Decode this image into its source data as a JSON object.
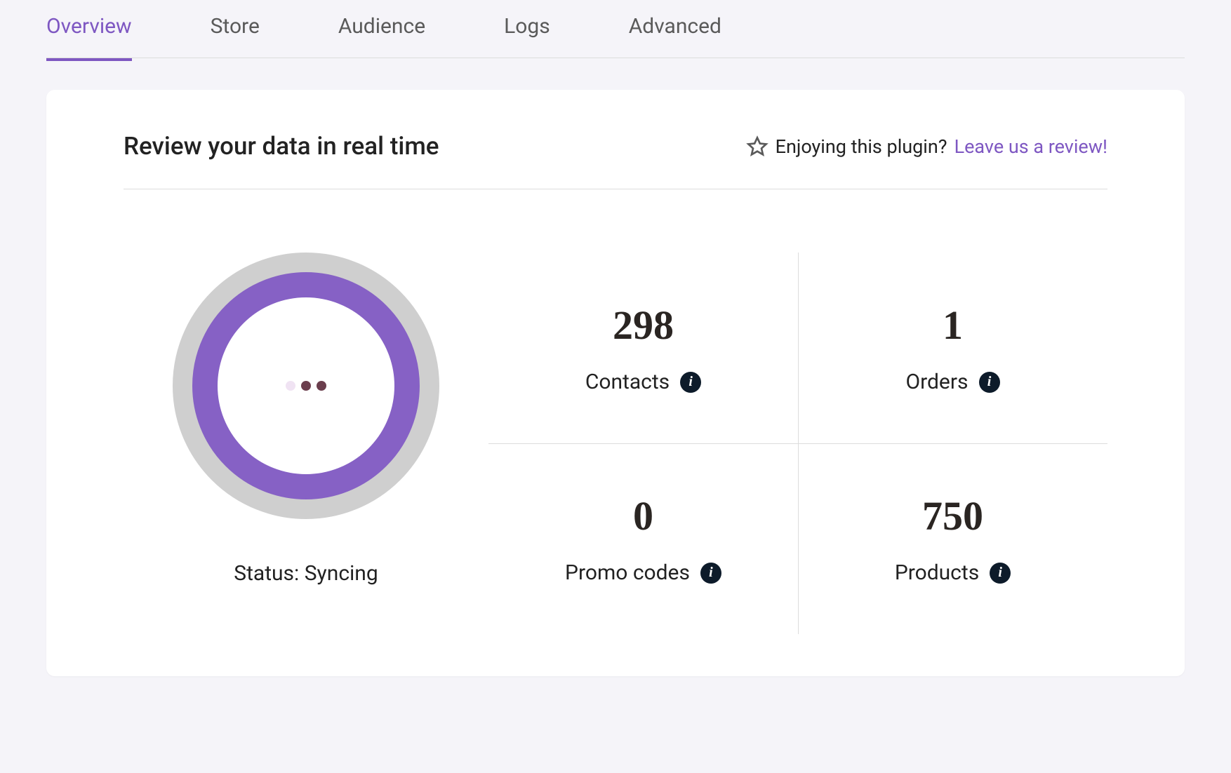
{
  "tabs": [
    {
      "label": "Overview",
      "active": true
    },
    {
      "label": "Store",
      "active": false
    },
    {
      "label": "Audience",
      "active": false
    },
    {
      "label": "Logs",
      "active": false
    },
    {
      "label": "Advanced",
      "active": false
    }
  ],
  "card": {
    "title": "Review your data in real time",
    "review_prompt": "Enjoying this plugin?",
    "review_link": "Leave us a review!"
  },
  "status": {
    "label": "Status: Syncing"
  },
  "stats": {
    "contacts": {
      "value": "298",
      "label": "Contacts"
    },
    "orders": {
      "value": "1",
      "label": "Orders"
    },
    "promo_codes": {
      "value": "0",
      "label": "Promo codes"
    },
    "products": {
      "value": "750",
      "label": "Products"
    }
  },
  "colors": {
    "accent": "#7e57c2",
    "spinner_ring": "#8661c5",
    "spinner_bg_ring": "#cfcfcf",
    "page_bg": "#f5f4f9"
  }
}
